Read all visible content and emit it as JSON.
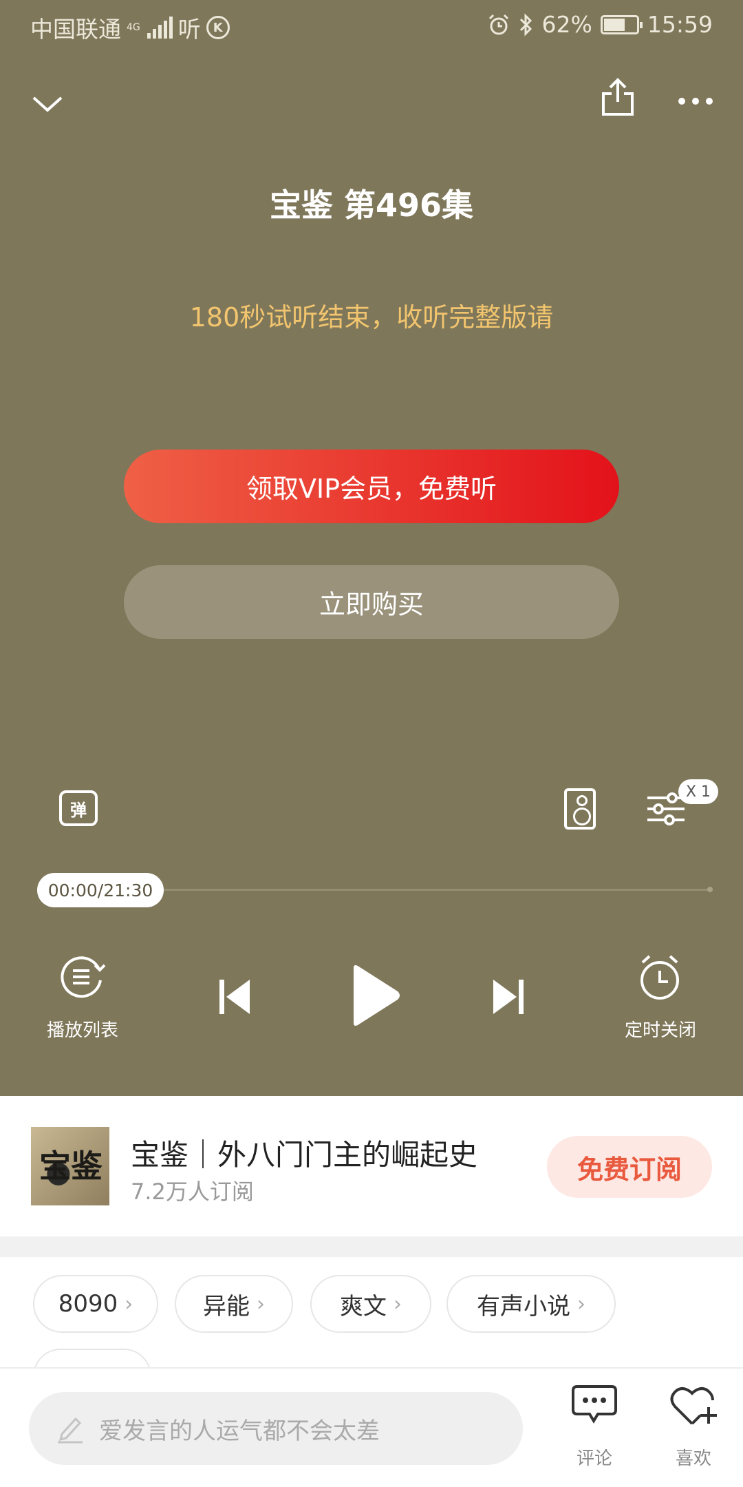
{
  "status_bar": {
    "carrier": "中国联通",
    "network": "4G",
    "app_label": "听",
    "battery": "62%",
    "time": "15:59"
  },
  "header": {
    "icons": [
      "chevron-down-icon",
      "share-icon",
      "more-icon"
    ]
  },
  "player": {
    "episode_title": "宝鉴 第496集",
    "trial_notice": "180秒试听结束，收听完整版请",
    "vip_button": "领取VIP会员，免费听",
    "buy_button": "立即购买",
    "danmaku_label": "弹",
    "speed_badge": "X 1",
    "time_display": "00:00/21:30",
    "progress": 0,
    "playlist_label": "播放列表",
    "timer_label": "定时关闭"
  },
  "album": {
    "cover_text": "宝鉴",
    "title": "宝鉴｜外八门门主的崛起史",
    "subscribers": "7.2万人订阅",
    "subscribe_button": "免费订阅"
  },
  "tags": [
    {
      "label": "8090"
    },
    {
      "label": "异能"
    },
    {
      "label": "爽文"
    },
    {
      "label": "有声小说"
    }
  ],
  "bottom_bar": {
    "comment_placeholder": "爱发言的人运气都不会太差",
    "comment_label": "评论",
    "like_label": "喜欢"
  },
  "colors": {
    "player_bg": "#7f775a",
    "vip_gradient_start": "#ef6046",
    "vip_gradient_end": "#e3121a",
    "trial_notice": "#f2c56e",
    "subscribe_text": "#e8593d"
  }
}
